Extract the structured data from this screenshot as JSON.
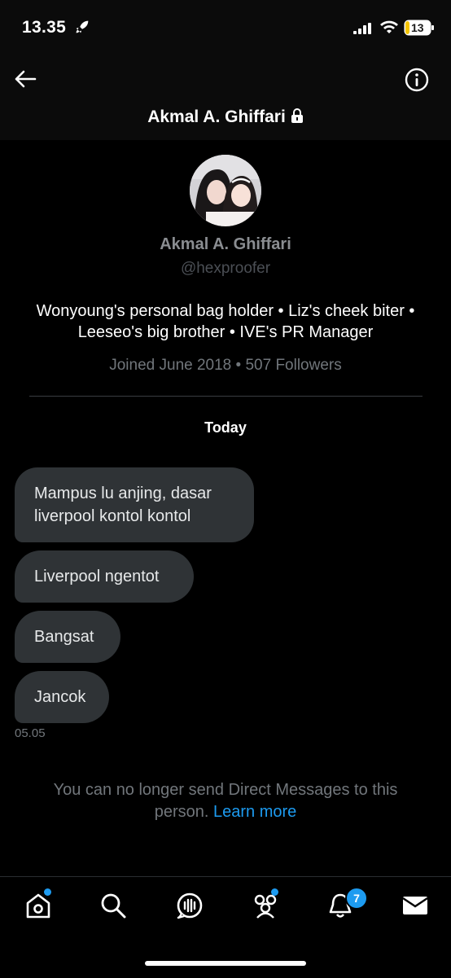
{
  "status_bar": {
    "time": "13.35",
    "battery": "13"
  },
  "header": {
    "title": "Akmal A. Ghiffari"
  },
  "profile": {
    "name": "Akmal A. Ghiffari",
    "handle": "@hexproofer",
    "bio": "Wonyoung's personal bag holder • Liz's cheek biter • Leeseo's big brother • IVE's PR Manager",
    "meta": "Joined June 2018 • 507 Followers"
  },
  "day_label": "Today",
  "messages": [
    {
      "text": "Mampus lu anjing, dasar liverpool kontol kontol"
    },
    {
      "text": "Liverpool ngentot"
    },
    {
      "text": "Bangsat"
    },
    {
      "text": "Jancok"
    }
  ],
  "timestamp": "05.05",
  "notice": {
    "text": "You can no longer send Direct Messages to this person.",
    "link": "Learn more"
  },
  "tabs": [
    "home",
    "search",
    "spaces",
    "communities",
    "notifications",
    "messages"
  ],
  "notification_badge": "7",
  "colors": {
    "accent": "#1d9bf0",
    "bubble": "#2f3336",
    "muted": "#71767b"
  },
  "icons": [
    "rocket-icon",
    "signal-icon",
    "wifi-icon",
    "battery-icon",
    "back-arrow-icon",
    "info-icon",
    "lock-icon",
    "home-icon",
    "search-icon",
    "spaces-icon",
    "communities-icon",
    "bell-icon",
    "mail-icon"
  ]
}
